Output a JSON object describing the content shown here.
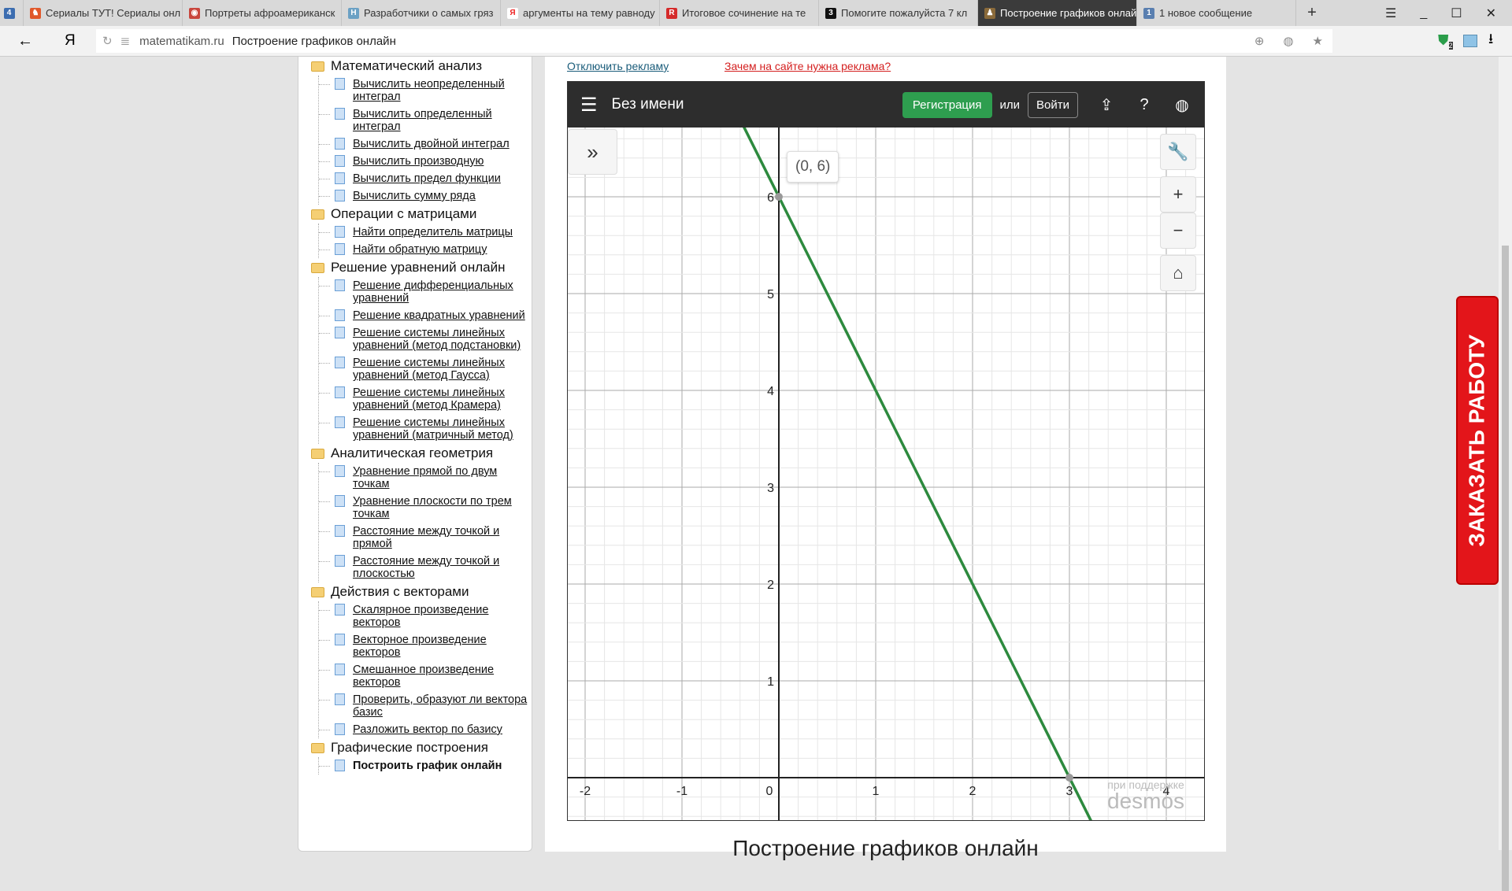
{
  "browser": {
    "tabs": [
      {
        "label": "Сериалы ТУТ! Сериалы онл",
        "color": "#e0582a",
        "glyph": "♞"
      },
      {
        "label": "Портреты афроамериканск",
        "color": "#c9463d",
        "glyph": "◉"
      },
      {
        "label": "Разработчики о самых гряз",
        "color": "#6ba1c4",
        "glyph": "H"
      },
      {
        "label": "аргументы на тему равноду",
        "color": "#ffffff",
        "glyph": "Я"
      },
      {
        "label": "Итоговое сочинение на те",
        "color": "#d52b2b",
        "glyph": "R"
      },
      {
        "label": "Помогите пожалуйста 7 кл",
        "color": "#111111",
        "glyph": "3"
      },
      {
        "label": "Построение графиков онлайн",
        "color": "#8a6a3a",
        "glyph": "♟",
        "active": true
      },
      {
        "label": "1 новое сообщение",
        "color": "#5a7fb0",
        "glyph": "1"
      }
    ],
    "new_tab": "+",
    "domain": "matematikam.ru",
    "page_title": "Построение графиков онлайн",
    "extension_badge": "2"
  },
  "sidebar": [
    {
      "title": "Математический анализ",
      "items": [
        "Вычислить неопределенный интеграл",
        "Вычислить определенный интеграл",
        "Вычислить двойной интеграл",
        "Вычислить производную",
        "Вычислить предел функции",
        "Вычислить сумму ряда"
      ]
    },
    {
      "title": "Операции с матрицами",
      "items": [
        "Найти определитель матрицы",
        "Найти обратную матрицу"
      ]
    },
    {
      "title": "Решение уравнений онлайн",
      "items": [
        "Решение дифференциальных уравнений",
        "Решение квадратных уравнений",
        "Решение системы линейных уравнений (метод подстановки)",
        "Решение системы линейных уравнений (метод Гаусса)",
        "Решение системы линейных уравнений (метод Крамера)",
        "Решение системы линейных уравнений (матричный метод)"
      ]
    },
    {
      "title": "Аналитическая геометрия",
      "items": [
        "Уравнение прямой по двум точкам",
        "Уравнение плоскости по трем точкам",
        "Расстояние между точкой и прямой",
        "Расстояние между точкой и плоскостью"
      ]
    },
    {
      "title": "Действия с векторами",
      "items": [
        "Скалярное произведение векторов",
        "Векторное произведение векторов",
        "Смешанное произведение векторов",
        "Проверить, образуют ли вектора базис",
        "Разложить вектор по базису"
      ]
    },
    {
      "title": "Графические построения",
      "items": [
        "Построить график онлайн"
      ],
      "current": 0
    }
  ],
  "ads": {
    "disable": "Отключить рекламу",
    "why": "Зачем на сайте нужна реклама?"
  },
  "desmos": {
    "title": "Без имени",
    "register": "Регистрация",
    "or": "или",
    "login": "Войти",
    "powered": "при поддержке",
    "brand": "desmos"
  },
  "chart_data": {
    "type": "line",
    "series": [
      {
        "name": "y = -2x + 6",
        "points": [
          [
            -0.5,
            7
          ],
          [
            3.5,
            -1
          ]
        ],
        "color": "#2d8a3e"
      }
    ],
    "highlight_points": [
      [
        0,
        6
      ],
      [
        3,
        0
      ]
    ],
    "tooltip": "(0, 6)",
    "xlim": [
      -2.2,
      4.3
    ],
    "ylim": [
      -0.35,
      6.8
    ],
    "x_ticks": [
      "-2",
      "-1",
      "0",
      "1",
      "2",
      "3",
      "4"
    ],
    "y_ticks": [
      "1",
      "2",
      "3",
      "4",
      "5",
      "6"
    ],
    "grid": true
  },
  "side_button": "ЗАКАЗАТЬ РАБОТУ",
  "bottom_heading": "Построение графиков онлайн"
}
